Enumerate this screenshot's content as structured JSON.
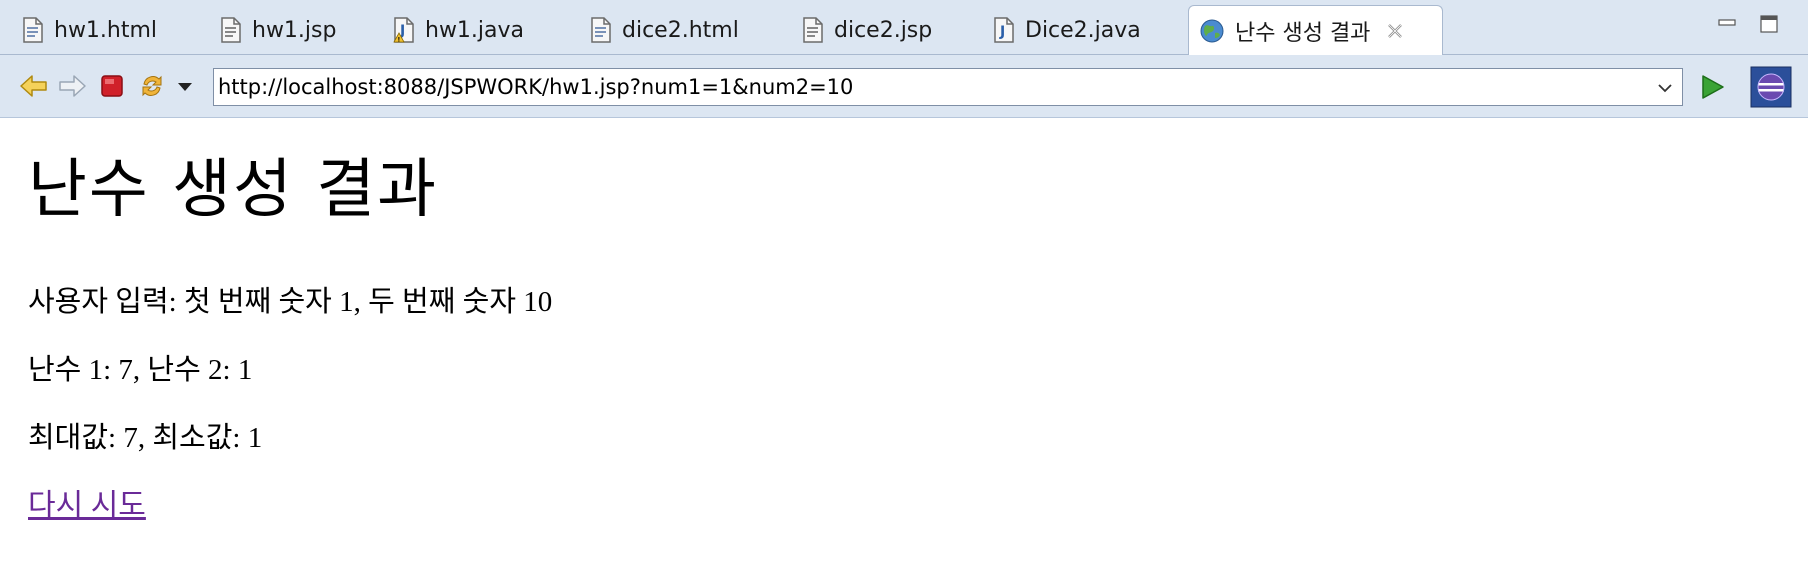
{
  "tabs": [
    {
      "label": "hw1.html",
      "icon": "html-file-icon"
    },
    {
      "label": "hw1.jsp",
      "icon": "jsp-file-icon"
    },
    {
      "label": "hw1.java",
      "icon": "java-file-warning-icon"
    },
    {
      "label": "dice2.html",
      "icon": "html-file-icon"
    },
    {
      "label": "dice2.jsp",
      "icon": "jsp-file-icon"
    },
    {
      "label": "Dice2.java",
      "icon": "java-file-icon"
    },
    {
      "label": "난수 생성 결과",
      "icon": "globe-icon"
    }
  ],
  "toolbar": {
    "url": "http://localhost:8088/JSPWORK/hw1.jsp?num1=1&num2=10"
  },
  "page": {
    "title": "난수 생성 결과",
    "input_line": "사용자 입력: 첫 번째 숫자 1, 두 번째 숫자 10",
    "random_line": "난수 1: 7, 난수 2: 1",
    "minmax_line": "최대값: 7, 최소값: 1",
    "retry_link": "다시 시도"
  },
  "colors": {
    "chrome_bg": "#dce6f2",
    "link_visited": "#6a2a98",
    "stop_red": "#d0202a",
    "go_green": "#3aa335"
  }
}
